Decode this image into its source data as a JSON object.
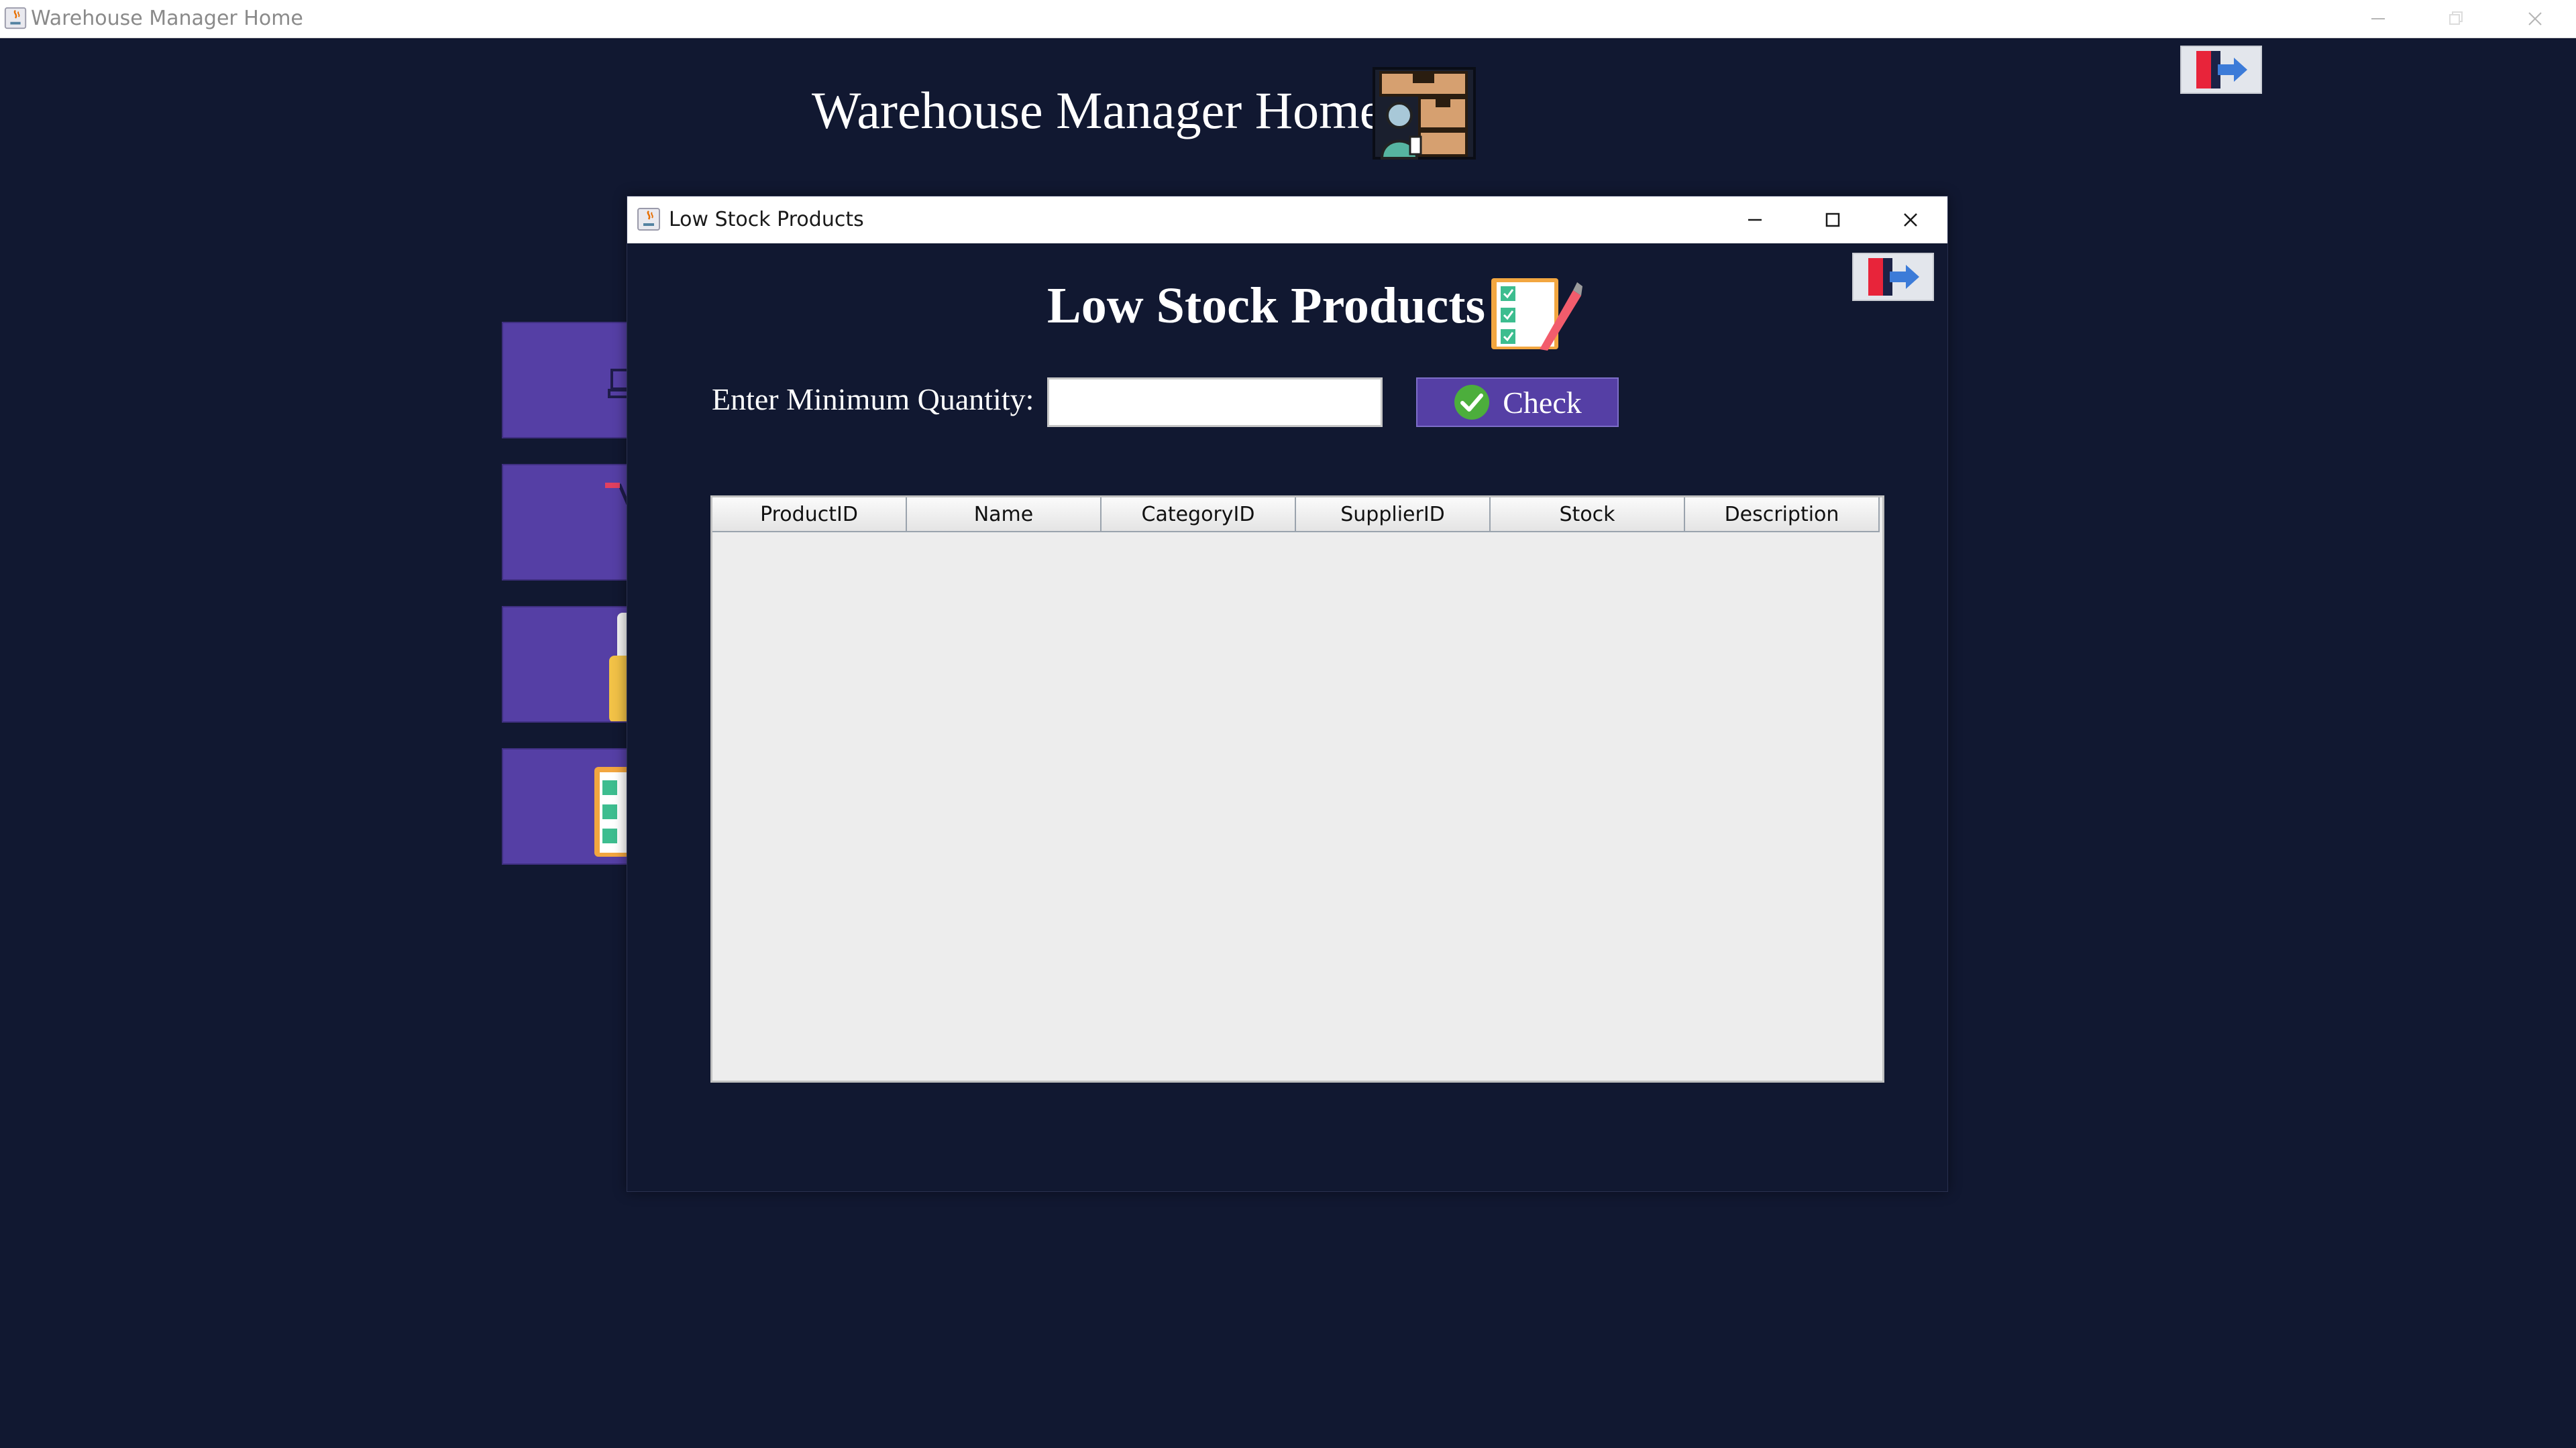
{
  "main_window": {
    "title": "Warehouse Manager Home",
    "header_title": "Warehouse Manager Home"
  },
  "dialog": {
    "title": "Low Stock Products",
    "heading": "Low Stock Products",
    "min_quantity_label": "Enter Minimum Quantity:",
    "min_quantity_value": "",
    "check_label": "Check",
    "table": {
      "columns": [
        "ProductID",
        "Name",
        "CategoryID",
        "SupplierID",
        "Stock",
        "Description"
      ],
      "rows": []
    }
  },
  "colors": {
    "background": "#111831",
    "accent_purple": "#553fa5",
    "table_background": "#ededed"
  },
  "icons": [
    "java-app-icon",
    "exit-door-icon",
    "warehouse-manager-icon",
    "checklist-pencil-icon",
    "checkmark-circle-icon",
    "minimize-icon",
    "maximize-icon",
    "close-icon"
  ]
}
